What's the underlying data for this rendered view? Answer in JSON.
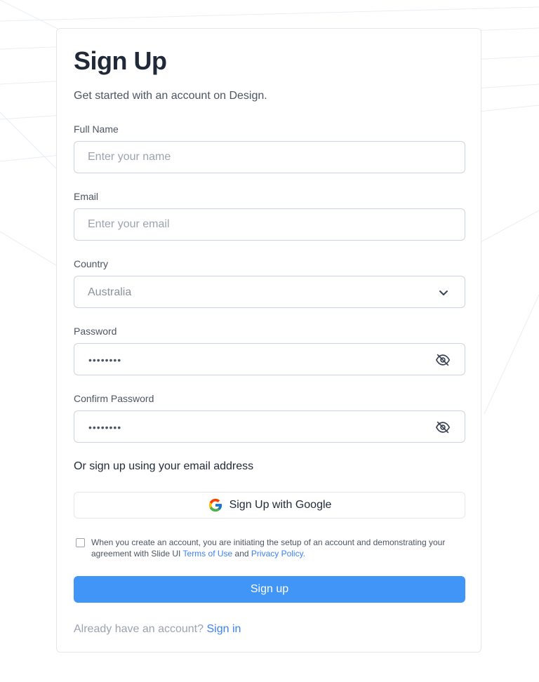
{
  "form": {
    "title": "Sign Up",
    "subtitle": "Get started with an account on Design.",
    "full_name": {
      "label": "Full Name",
      "placeholder": "Enter your name"
    },
    "email": {
      "label": "Email",
      "placeholder": "Enter your email"
    },
    "country": {
      "label": "Country",
      "selected": "Australia"
    },
    "password": {
      "label": "Password",
      "masked": "••••••••"
    },
    "confirm_password": {
      "label": "Confirm Password",
      "masked": "••••••••"
    },
    "alt_text": "Or sign up using your email address",
    "google_button": "Sign Up with Google",
    "terms": {
      "prefix": "When you create an account, you are initiating the setup of an account and demonstrating your agreement with Slide UI ",
      "terms_link": "Terms of Use",
      "and": " and ",
      "privacy_link": "Privacy Policy."
    },
    "submit_label": "Sign up",
    "signin": {
      "prompt": "Already have an account? ",
      "link": "Sign in"
    }
  },
  "icons": {
    "country_chevron": "chevron-down-icon",
    "password_toggle": "eye-off-icon",
    "google": "google-icon"
  },
  "colors": {
    "primary": "#4095f6",
    "link": "#3b82f6",
    "border": "#cbd5e1"
  }
}
